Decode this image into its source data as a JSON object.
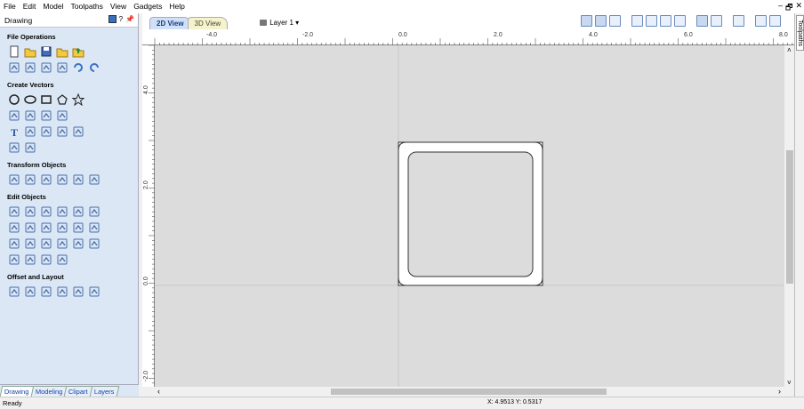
{
  "menu": [
    "File",
    "Edit",
    "Model",
    "Toolpaths",
    "View",
    "Gadgets",
    "Help"
  ],
  "window_controls": [
    "–",
    "🗗",
    "✕"
  ],
  "left_panel": {
    "title": "Drawing",
    "header_icons": [
      "?",
      "📌"
    ],
    "sections": [
      {
        "title": "File Operations",
        "rows": [
          [
            "new-file",
            "open-folder",
            "save",
            "open-file",
            "import"
          ],
          [
            "select-all",
            "cut",
            "copy",
            "paste",
            "undo",
            "redo"
          ]
        ]
      },
      {
        "title": "Create Vectors",
        "rows": [
          [
            "circle",
            "ellipse",
            "rectangle",
            "polygon",
            "star"
          ],
          [
            "polyline",
            "arc",
            "curve",
            "spiral"
          ],
          [
            "text",
            "text-frame",
            "text-on-curve",
            "text-arrange",
            "text-adjust"
          ],
          [
            "dimension",
            "measure"
          ]
        ]
      },
      {
        "title": "Transform Objects",
        "rows": [
          [
            "move",
            "scale",
            "align",
            "mirror",
            "distort",
            "center"
          ]
        ]
      },
      {
        "title": "Edit Objects",
        "rows": [
          [
            "select",
            "node-edit",
            "smooth",
            "group",
            "ungroup",
            "trim"
          ],
          [
            "weld",
            "subtract",
            "intersect",
            "boolean",
            "scissors",
            "fillet"
          ],
          [
            "offset-left",
            "chevron",
            "curve-fit",
            "arrow",
            "image-trace",
            "image"
          ],
          [
            "outline",
            "bracket",
            "greater",
            "brace"
          ]
        ]
      },
      {
        "title": "Offset and Layout",
        "rows": [
          [
            "offset",
            "array",
            "circular-array",
            "nest",
            "layout-grid",
            "pattern"
          ]
        ]
      }
    ],
    "tabs": [
      "Drawing",
      "Modeling",
      "Clipart",
      "Layers"
    ]
  },
  "view_tabs": [
    "2D View",
    "3D View"
  ],
  "layer_label": "Layer 1 ▾",
  "ruler_top_labels": [
    "-4.0",
    "-2.0",
    "0.0",
    "2.0",
    "4.0",
    "6.0",
    "8.0"
  ],
  "ruler_left_labels": [
    "4.0",
    "2.0",
    "0.0",
    "-2.0"
  ],
  "right_tab": "Toolpaths",
  "status": {
    "text": "Ready",
    "coords": "X: 4.9513 Y: 0.5317"
  }
}
